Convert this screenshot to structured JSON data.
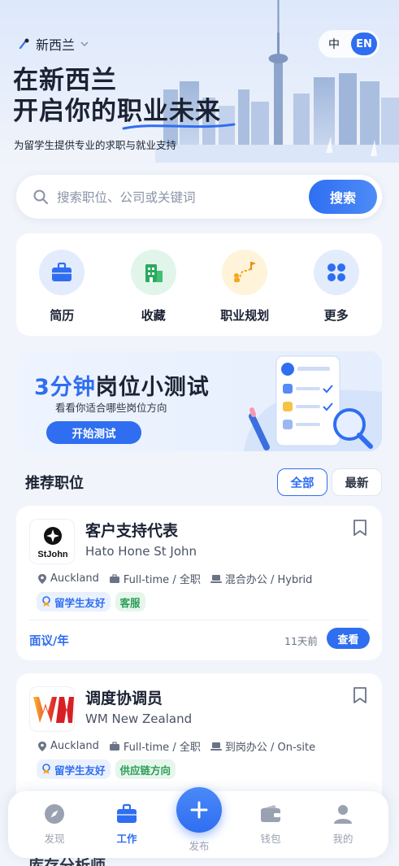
{
  "header": {
    "location": "新西兰",
    "lang_zh": "中",
    "lang_en": "EN",
    "headline_line1": "在新西兰",
    "headline_line2": "开启你的职业未来",
    "subtitle": "为留学生提供专业的求职与就业支持"
  },
  "search": {
    "placeholder": "搜索职位、公司或关键词",
    "button": "搜索"
  },
  "quick_actions": [
    {
      "label": "简历",
      "icon": "briefcase-icon"
    },
    {
      "label": "收藏",
      "icon": "building-icon"
    },
    {
      "label": "职业规划",
      "icon": "career-path-icon"
    },
    {
      "label": "更多",
      "icon": "grid-icon"
    }
  ],
  "banner": {
    "title_num": "3分钟",
    "title_rest": "岗位小测试",
    "subtitle": "看看你适合哪些岗位方向",
    "button": "开始测试"
  },
  "section": {
    "title": "推荐职位",
    "filter_all": "全部",
    "filter_new": "最新"
  },
  "jobs": [
    {
      "title": "客户支持代表",
      "company": "Hato Hone St John",
      "logo_text": "StJohn",
      "location": "Auckland",
      "type": "Full-time / 全职",
      "mode": "混合办公 / Hybrid",
      "tags": [
        "留学生友好",
        "客服"
      ],
      "salary": "面议/年",
      "posted": "11天前",
      "action": "查看"
    },
    {
      "title": "调度协调员",
      "company": "WM New Zealand",
      "location": "Auckland",
      "type": "Full-time / 全职",
      "mode": "到岗办公 / On-site",
      "tags": [
        "留学生友好",
        "供应链方向"
      ]
    }
  ],
  "peek_title": "库存分析师",
  "tabbar": {
    "discover": "发现",
    "work": "工作",
    "publish": "发布",
    "wallet": "钱包",
    "me": "我的"
  },
  "colors": {
    "accent": "#2f6ef1",
    "tag_green": "#2b9c56",
    "background": "#f1f4fa"
  }
}
